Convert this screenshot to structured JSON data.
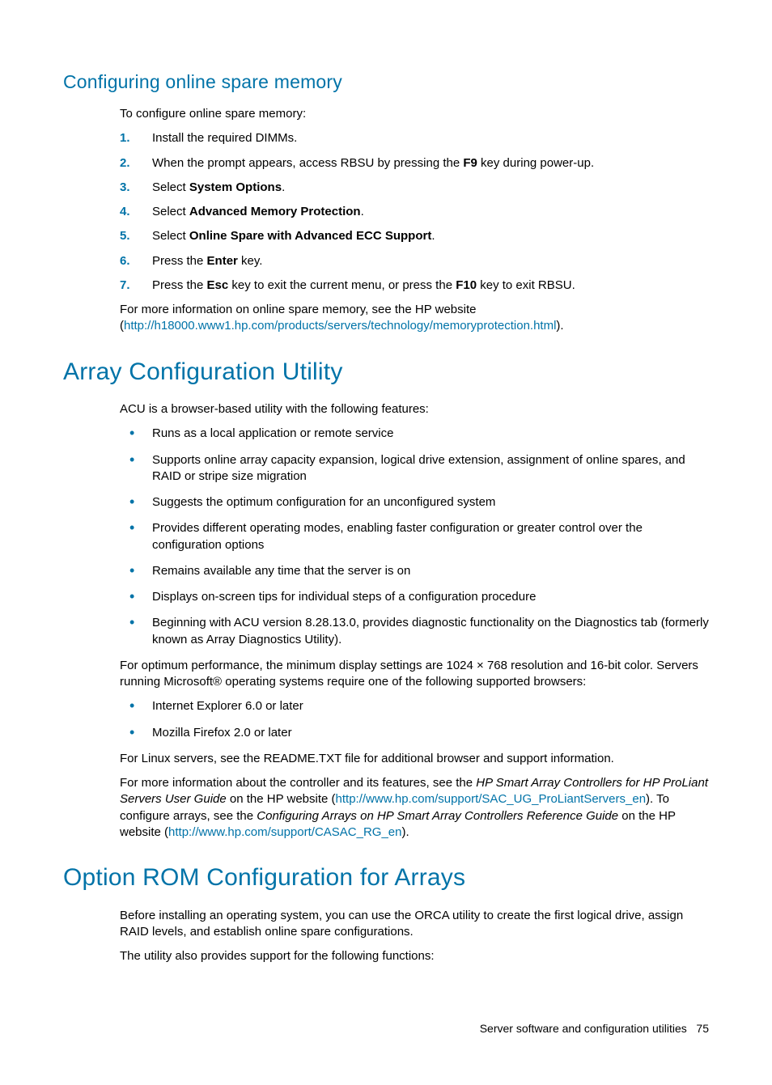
{
  "sec1": {
    "title": "Configuring online spare memory",
    "intro": "To configure online spare memory:",
    "steps": [
      {
        "n": "1.",
        "text": "Install the required DIMMs."
      },
      {
        "n": "2.",
        "pre": "When the prompt appears, access RBSU by pressing the ",
        "b1": "F9",
        "post": " key during power-up."
      },
      {
        "n": "3.",
        "pre": "Select ",
        "b1": "System Options",
        "post": "."
      },
      {
        "n": "4.",
        "pre": "Select ",
        "b1": "Advanced Memory Protection",
        "post": "."
      },
      {
        "n": "5.",
        "pre": "Select ",
        "b1": "Online Spare with Advanced ECC Support",
        "post": "."
      },
      {
        "n": "6.",
        "pre": "Press the ",
        "b1": "Enter",
        "post": " key."
      },
      {
        "n": "7.",
        "pre": "Press the ",
        "b1": "Esc",
        "mid": " key to exit the current menu, or press the ",
        "b2": "F10",
        "post": " key to exit RBSU."
      }
    ],
    "outro_pre": "For more information on online spare memory, see the HP website (",
    "outro_link": "http://h18000.www1.hp.com/products/servers/technology/memoryprotection.html",
    "outro_post": ")."
  },
  "sec2": {
    "title": "Array Configuration Utility",
    "intro": "ACU is a browser-based utility with the following features:",
    "features": [
      "Runs as a local application or remote service",
      "Supports online array capacity expansion, logical drive extension, assignment of online spares, and RAID or stripe size migration",
      "Suggests the optimum configuration for an unconfigured system",
      "Provides different operating modes, enabling faster configuration or greater control over the configuration options",
      "Remains available any time that the server is on",
      "Displays on-screen tips for individual steps of a configuration procedure",
      "Beginning with ACU version 8.28.13.0, provides diagnostic functionality on the Diagnostics tab (formerly known as Array Diagnostics Utility)."
    ],
    "perf": "For optimum performance, the minimum display settings are 1024 × 768 resolution and 16-bit color. Servers running Microsoft® operating systems require one of the following supported browsers:",
    "browsers": [
      "Internet Explorer 6.0 or later",
      "Mozilla Firefox 2.0 or later"
    ],
    "linux": "For Linux servers, see the README.TXT file for additional browser and support information.",
    "more": {
      "t1": "For more information about the controller and its features, see the ",
      "i1": "HP Smart Array Controllers for HP ProLiant Servers User Guide",
      "t2": " on the HP website (",
      "l1": "http://www.hp.com/support/SAC_UG_ProLiantServers_en",
      "t3": "). To configure arrays, see the ",
      "i2": "Configuring Arrays on HP Smart Array Controllers Reference Guide",
      "t4": " on the HP website (",
      "l2": "http://www.hp.com/support/CASAC_RG_en",
      "t5": ")."
    }
  },
  "sec3": {
    "title": "Option ROM Configuration for Arrays",
    "p1": "Before installing an operating system, you can use the ORCA utility to create the first logical drive, assign RAID levels, and establish online spare configurations.",
    "p2": "The utility also provides support for the following functions:"
  },
  "footer": {
    "label": "Server software and configuration utilities",
    "page": "75"
  }
}
